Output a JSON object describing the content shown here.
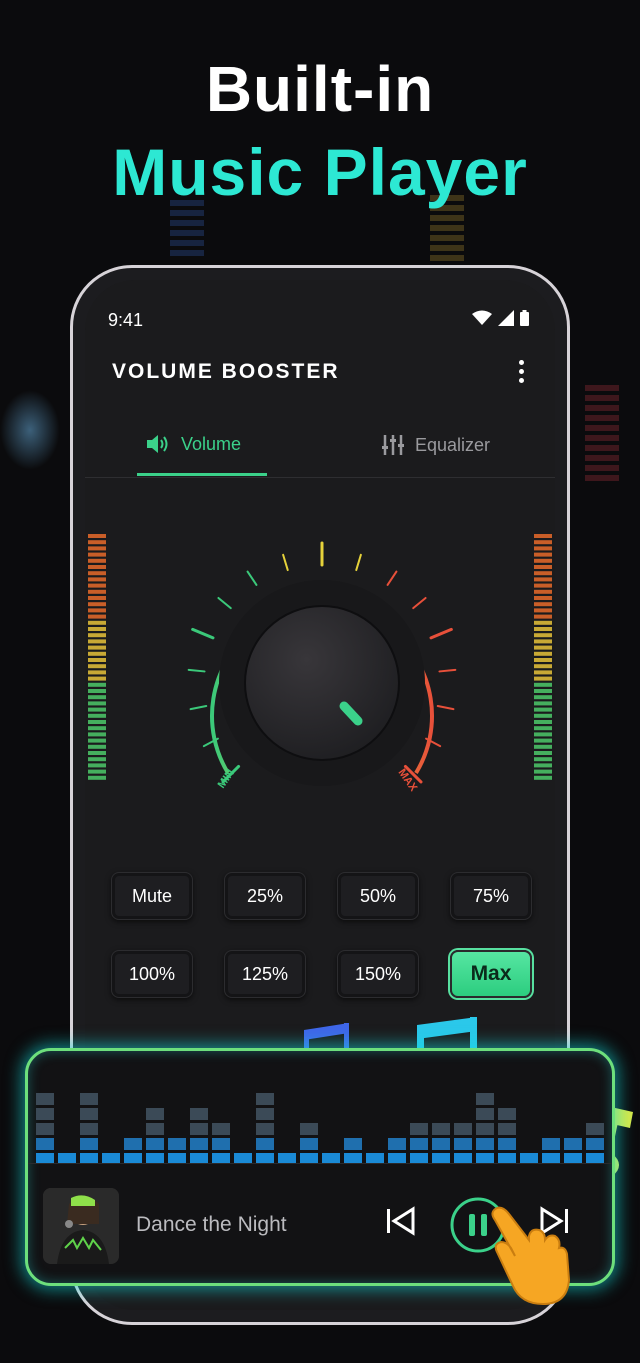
{
  "headline": {
    "line1": "Built-in",
    "line2": "Music Player"
  },
  "status_bar": {
    "time": "9:41"
  },
  "app": {
    "title": "VOLUME BOOSTER"
  },
  "tabs": [
    {
      "label": "Volume",
      "icon": "speaker-icon",
      "active": true
    },
    {
      "label": "Equalizer",
      "icon": "sliders-icon",
      "active": false
    }
  ],
  "knob": {
    "min_label": "MIN",
    "max_label": "MAX"
  },
  "presets": [
    {
      "label": "Mute",
      "active": false
    },
    {
      "label": "25%",
      "active": false
    },
    {
      "label": "50%",
      "active": false
    },
    {
      "label": "75%",
      "active": false
    },
    {
      "label": "100%",
      "active": false
    },
    {
      "label": "125%",
      "active": false
    },
    {
      "label": "150%",
      "active": false
    },
    {
      "label": "Max",
      "active": true
    }
  ],
  "player": {
    "song_title": "Dance the Night",
    "state": "playing"
  },
  "colors": {
    "accent_green": "#3bd18a",
    "headline_cyan": "#2de8d3",
    "player_glow": "#1ee0e0"
  }
}
